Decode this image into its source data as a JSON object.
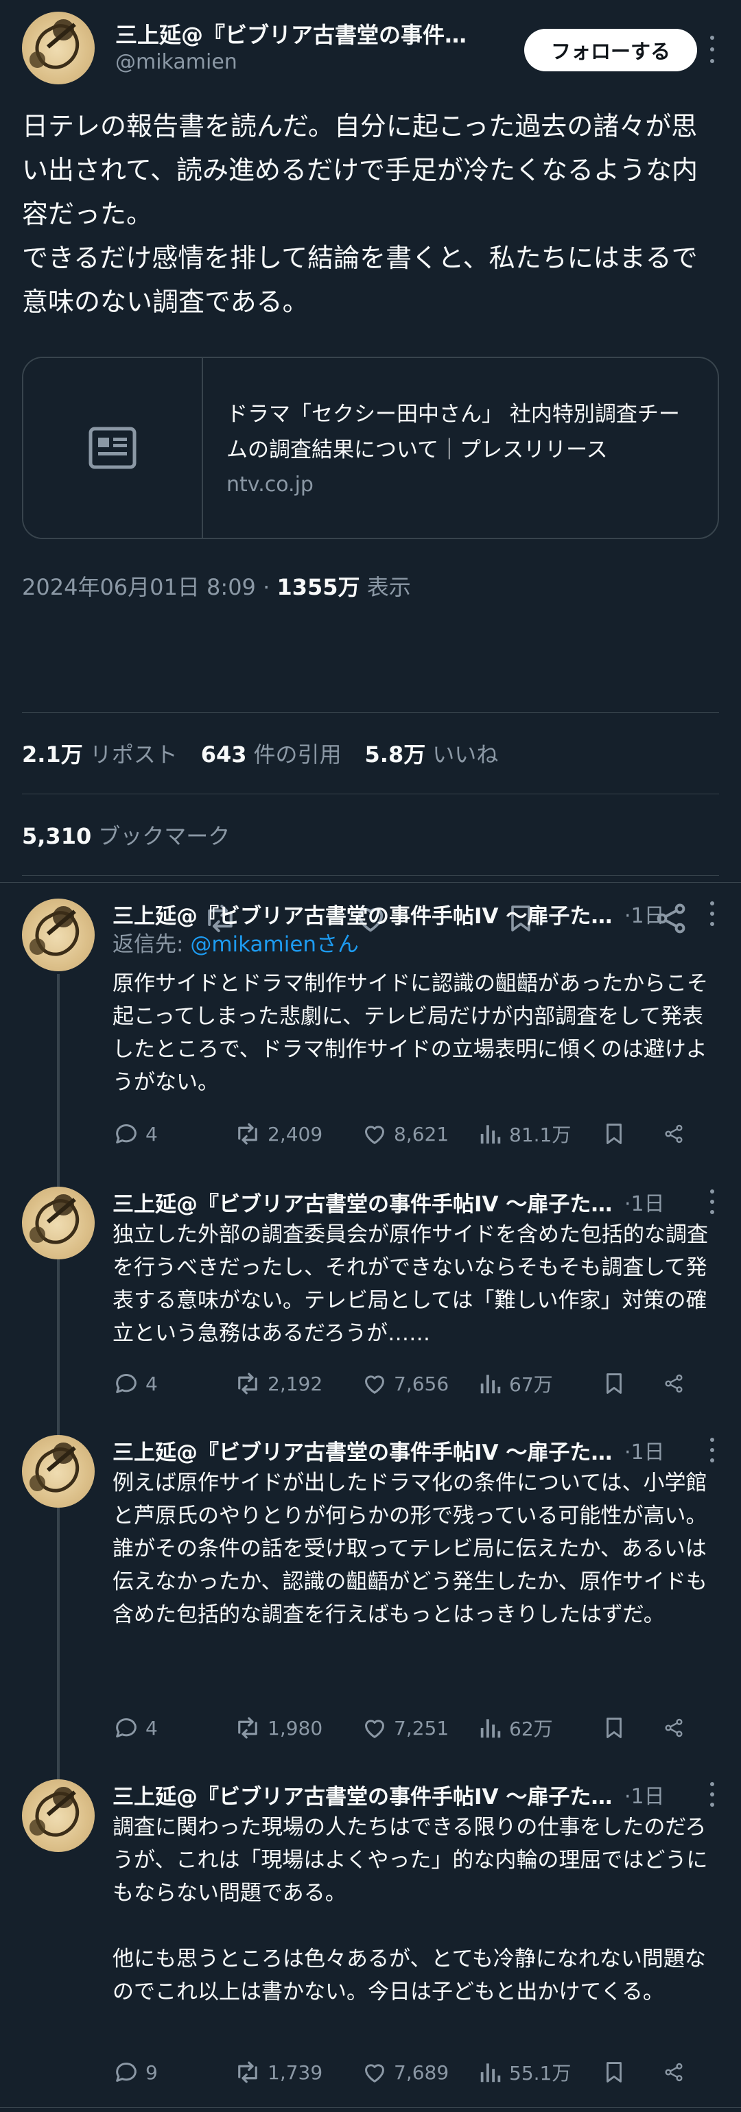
{
  "main_tweet": {
    "display_name": "三上延@『ビブリア古書堂の事件手帖IV 〜扉子たちと継がれる道〜』",
    "handle": "@mikamien",
    "follow_label": "フォローする",
    "text": "日テレの報告書を読んだ。自分に起こった過去の諸々が思い出されて、読み進めるだけで手足が冷たくなるような内容だった。\nできるだけ感情を排して結論を書くと、私たちにはまるで意味のない調査である。",
    "card": {
      "title": "ドラマ「セクシー田中さん」 社内特別調査チームの調査結果について｜プレスリリース",
      "domain": "ntv.co.jp"
    },
    "timestamp": "2024年06月01日 8:09",
    "views_count": "1355万",
    "views_label": "表示",
    "reposts_count": "2.1万",
    "reposts_label": "リポスト",
    "quotes_count": "643",
    "quotes_label": "件の引用",
    "likes_count": "5.8万",
    "likes_label": "いいね",
    "bookmarks_count": "5,310",
    "bookmarks_label": "ブックマーク"
  },
  "replies": [
    {
      "display_name": "三上延@『ビブリア古書堂の事件手帖IV 〜扉子たちと継がれる道〜』",
      "time": "1日",
      "reply_to_prefix": "返信先: ",
      "reply_to_handle": "@mikamienさん",
      "text": "原作サイドとドラマ制作サイドに認識の齟齬があったからこそ起こってしまった悲劇に、テレビ局だけが内部調査をして発表したところで、ドラマ制作サイドの立場表明に傾くのは避けようがない。",
      "replies": "4",
      "reposts": "2,409",
      "likes": "8,621",
      "views": "81.1万"
    },
    {
      "display_name": "三上延@『ビブリア古書堂の事件手帖IV 〜扉子たちと継がれる道〜』",
      "time": "1日",
      "text": "独立した外部の調査委員会が原作サイドを含めた包括的な調査を行うべきだったし、それができないならそもそも調査して発表する意味がない。テレビ局としては「難しい作家」対策の確立という急務はあるだろうが……",
      "replies": "4",
      "reposts": "2,192",
      "likes": "7,656",
      "views": "67万"
    },
    {
      "display_name": "三上延@『ビブリア古書堂の事件手帖IV 〜扉子たちと継がれる道〜』",
      "time": "1日",
      "text": "例えば原作サイドが出したドラマ化の条件については、小学館と芦原氏のやりとりが何らかの形で残っている可能性が高い。\n誰がその条件の話を受け取ってテレビ局に伝えたか、あるいは伝えなかったか、認識の齟齬がどう発生したか、原作サイドも含めた包括的な調査を行えばもっとはっきりしたはずだ。",
      "replies": "4",
      "reposts": "1,980",
      "likes": "7,251",
      "views": "62万"
    },
    {
      "display_name": "三上延@『ビブリア古書堂の事件手帖IV 〜扉子たちと継がれる道〜』",
      "time": "1日",
      "text": "調査に関わった現場の人たちはできる限りの仕事をしたのだろうが、これは「現場はよくやった」的な内輪の理屈ではどうにもならない問題である。\n\n他にも思うところは色々あるが、とても冷静になれない問題なのでこれ以上は書かない。今日は子どもと出かけてくる。",
      "replies": "9",
      "reposts": "1,739",
      "likes": "7,689",
      "views": "55.1万"
    }
  ],
  "icons": {
    "reply": "speech-bubble-icon",
    "repost": "repost-arrows-icon",
    "like": "heart-icon",
    "views": "bar-chart-icon",
    "bookmark": "bookmark-icon",
    "share": "share-icon",
    "more": "more-dots-icon",
    "card_thumb": "article-icon"
  },
  "colors": {
    "background": "#15202b",
    "text": "#f7f9f9",
    "muted": "#8b98a5",
    "link": "#1d9bf0",
    "border": "#38444d"
  }
}
